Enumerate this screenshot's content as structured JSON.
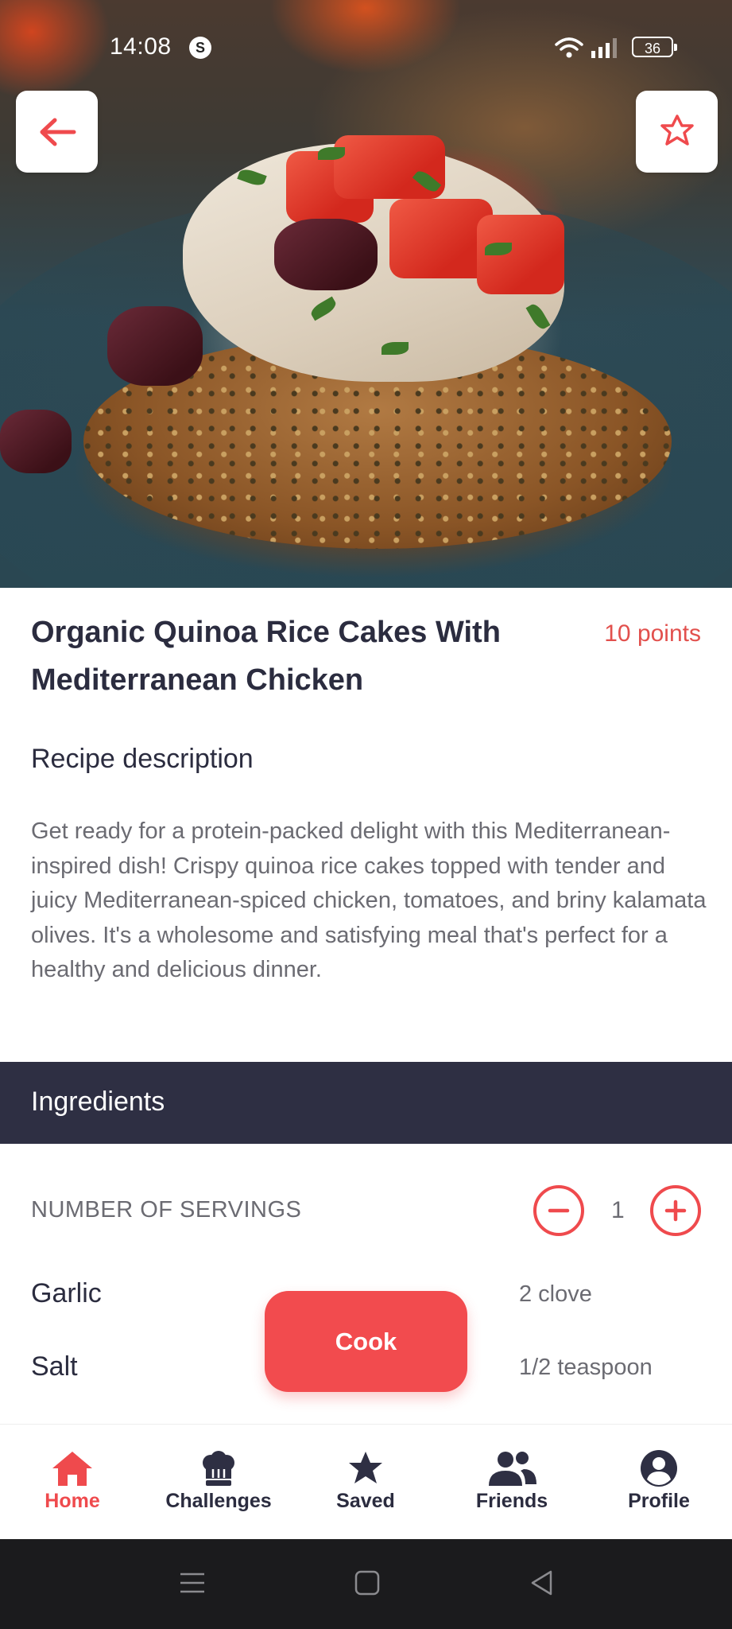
{
  "status_bar": {
    "time": "14:08",
    "battery": "36"
  },
  "header": {
    "back_icon": "arrow-left-icon",
    "favorite_icon": "star-icon"
  },
  "recipe": {
    "title": "Organic Quinoa Rice Cakes With Mediterranean Chicken",
    "points": "10 points",
    "description_heading": "Recipe description",
    "description": "Get ready for a protein-packed delight with this Mediterranean-inspired dish! Crispy quinoa rice cakes topped with tender and juicy Mediterranean-spiced chicken, tomatoes, and briny kalamata olives. It's a wholesome and satisfying meal that's perfect for a healthy and delicious dinner."
  },
  "ingredients": {
    "heading": "Ingredients",
    "servings_label": "NUMBER OF SERVINGS",
    "servings_value": "1",
    "items": [
      {
        "name": "Garlic",
        "quantity": "2 clove"
      },
      {
        "name": "Salt",
        "quantity": "1/2 teaspoon"
      }
    ]
  },
  "cook_button": "Cook",
  "nav": {
    "items": [
      {
        "label": "Home",
        "icon": "home-icon",
        "active": true
      },
      {
        "label": "Challenges",
        "icon": "chef-hat-icon",
        "active": false
      },
      {
        "label": "Saved",
        "icon": "star-icon",
        "active": false
      },
      {
        "label": "Friends",
        "icon": "people-icon",
        "active": false
      },
      {
        "label": "Profile",
        "icon": "user-circle-icon",
        "active": false
      }
    ]
  },
  "colors": {
    "accent": "#ef4a4d",
    "dark": "#2e2f43",
    "text_muted": "#6b6b72"
  }
}
